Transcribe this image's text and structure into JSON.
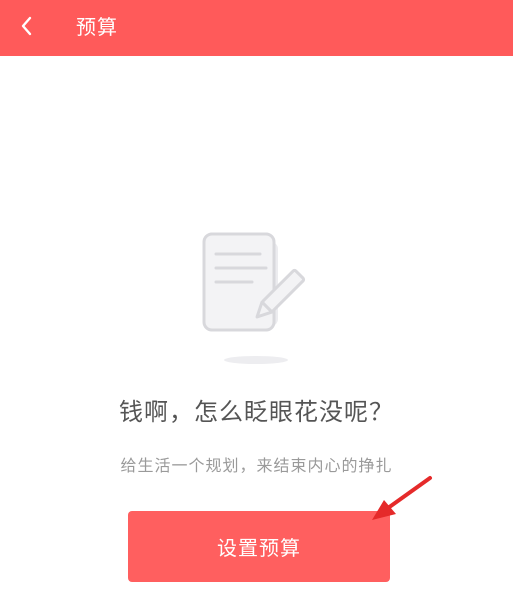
{
  "header": {
    "title": "预算",
    "back_icon": "chevron-left-icon"
  },
  "empty_state": {
    "illustration_icon": "note-edit-icon",
    "title": "钱啊，怎么眨眼花没呢？",
    "subtitle": "给生活一个规划，来结束内心的挣扎"
  },
  "actions": {
    "set_budget_label": "设置预算"
  },
  "colors": {
    "accent": "#ff5a5a",
    "annotation_arrow": "#e52a2a"
  }
}
